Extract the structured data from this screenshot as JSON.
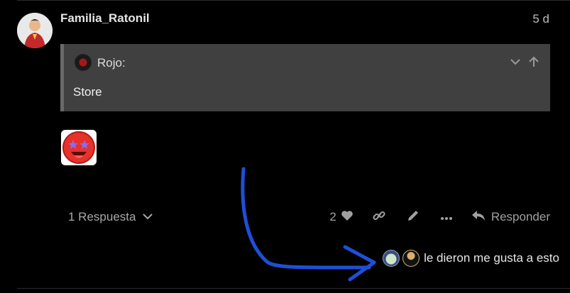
{
  "post": {
    "username": "Familia_Ratonil",
    "date": "5 d"
  },
  "quote": {
    "author": "Rojo:",
    "text": "Store"
  },
  "footer": {
    "replies_label": "1 Respuesta",
    "like_count": "2",
    "reply_label": "Responder"
  },
  "likes": {
    "text": "le dieron me gusta a esto"
  },
  "icons": {
    "expand": "chevron-down-icon",
    "go_to_quote": "arrow-up-icon",
    "like": "heart-icon",
    "share": "link-icon",
    "edit": "pencil-icon",
    "more": "ellipsis-icon",
    "reply": "reply-arrow-icon"
  },
  "colors": {
    "background": "#000000",
    "quote_background": "#404040",
    "annotation_arrow": "#1f4fd8"
  }
}
